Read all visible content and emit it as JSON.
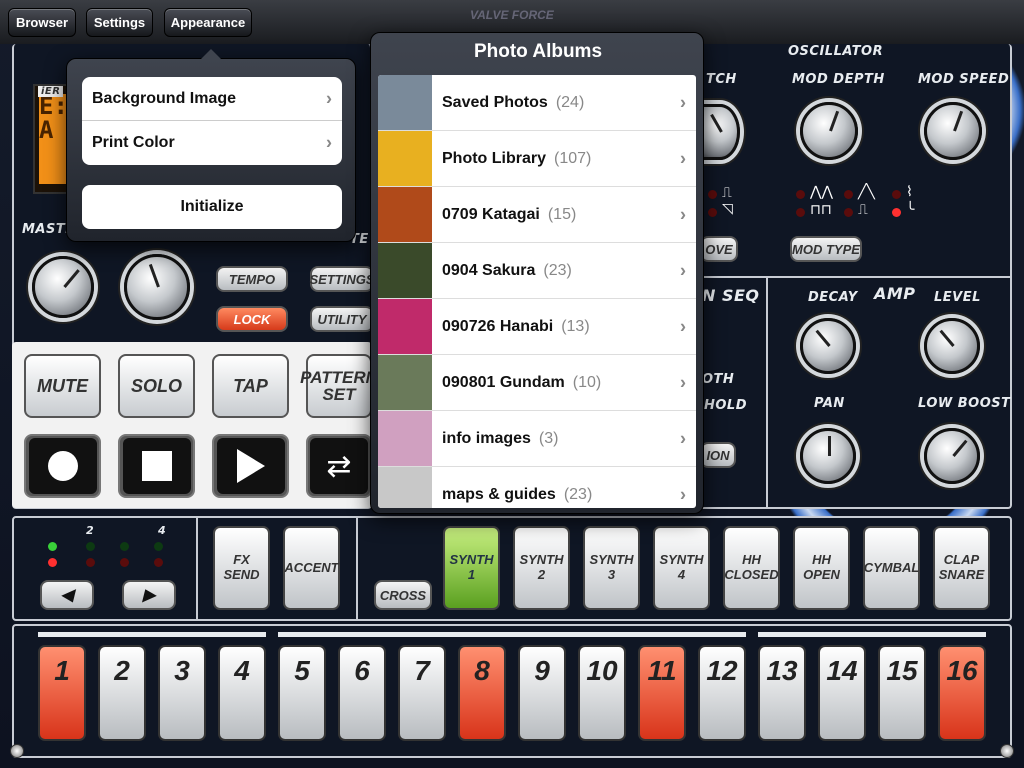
{
  "topbar": {
    "browser": "Browser",
    "settings": "Settings",
    "appearance": "Appearance"
  },
  "brand": "VALVE FORCE",
  "labels": {
    "oscillator": "OSCILLATOR",
    "mod_depth": "MOD DEPTH",
    "mod_speed": "MOD SPEED",
    "pitch": "TCH",
    "master": "MASTE",
    "amp": "AMP",
    "decay": "DECAY",
    "level": "LEVEL",
    "pan": "PAN",
    "low_boost": "LOW BOOST",
    "seq": "N SEQ",
    "oth": "OTH",
    "hold": "HOLD",
    "ove": "OVE",
    "ion": "ION",
    "te": "TE",
    "ier": "iER"
  },
  "buttons": {
    "tempo": "TEMPO",
    "lock": "LOCK",
    "settings": "SETTINGS",
    "utility": "UTILITY",
    "mute": "MUTE",
    "solo": "SOLO",
    "tap": "TAP",
    "pattern_set": "PATTERN SET",
    "mod_type": "MOD TYPE",
    "cross": "CROSS",
    "fx_send": "FX\nSEND",
    "accent": "ACCENT"
  },
  "lcd": "E:\nA",
  "track_numbers": [
    "2",
    "4"
  ],
  "instruments": [
    {
      "label": "SYNTH\n1",
      "active": true
    },
    {
      "label": "SYNTH\n2",
      "active": false
    },
    {
      "label": "SYNTH\n3",
      "active": false
    },
    {
      "label": "SYNTH\n4",
      "active": false
    },
    {
      "label": "HH\nCLOSED",
      "active": false
    },
    {
      "label": "HH\nOPEN",
      "active": false
    },
    {
      "label": "CYMBAL",
      "active": false
    },
    {
      "label": "CLAP\nSNARE",
      "active": false
    }
  ],
  "steps": [
    {
      "n": "1",
      "on": true
    },
    {
      "n": "2",
      "on": false
    },
    {
      "n": "3",
      "on": false
    },
    {
      "n": "4",
      "on": false
    },
    {
      "n": "5",
      "on": false
    },
    {
      "n": "6",
      "on": false
    },
    {
      "n": "7",
      "on": false
    },
    {
      "n": "8",
      "on": true
    },
    {
      "n": "9",
      "on": false
    },
    {
      "n": "10",
      "on": false
    },
    {
      "n": "11",
      "on": true
    },
    {
      "n": "12",
      "on": false
    },
    {
      "n": "13",
      "on": false
    },
    {
      "n": "14",
      "on": false
    },
    {
      "n": "15",
      "on": false
    },
    {
      "n": "16",
      "on": true
    }
  ],
  "appearance_menu": {
    "background_image": "Background Image",
    "print_color": "Print Color",
    "initialize": "Initialize"
  },
  "albums_popover": {
    "title": "Photo Albums",
    "albums": [
      {
        "name": "Saved Photos",
        "count": "(24)",
        "thumb": "#7a8a9a"
      },
      {
        "name": "Photo Library",
        "count": "(107)",
        "thumb": "#e8b020"
      },
      {
        "name": "0709 Katagai",
        "count": "(15)",
        "thumb": "#b04a1a"
      },
      {
        "name": "0904 Sakura",
        "count": "(23)",
        "thumb": "#3a4a2a"
      },
      {
        "name": "090726 Hanabi",
        "count": "(13)",
        "thumb": "#c02a6a"
      },
      {
        "name": "090801 Gundam",
        "count": "(10)",
        "thumb": "#6a7a5a"
      },
      {
        "name": "info images",
        "count": "(3)",
        "thumb": "#d0a0c0"
      },
      {
        "name": "maps & guides",
        "count": "(23)",
        "thumb": "#c8c8c8"
      }
    ]
  }
}
